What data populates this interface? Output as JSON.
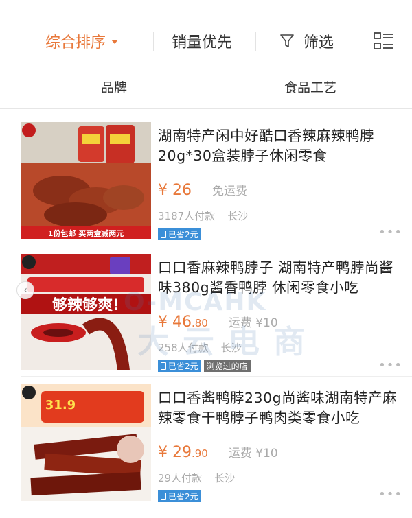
{
  "sort_bar": {
    "comprehensive": "综合排序",
    "sales": "销量优先",
    "filter": "筛选"
  },
  "sub_filters": {
    "brand": "品牌",
    "process": "食品工艺"
  },
  "products": [
    {
      "title": "湖南特产闲中好酷口香辣麻辣鸭脖20g*30盒装脖子休闲零食",
      "price_symbol": "¥",
      "price_int": "26",
      "price_dec": "",
      "shipping": "免运费",
      "paid": "3187人付款",
      "city": "长沙",
      "badges": [
        "已省2元"
      ],
      "more": "•••",
      "thumb_banner": "1份包邮 买两盒减两元"
    },
    {
      "title": "口口香麻辣鸭脖子 湖南特产鸭脖尚酱味380g酱香鸭脖 休闲零食小吃",
      "price_symbol": "¥",
      "price_int": "46",
      "price_dec": ".80",
      "shipping": "运费 ¥10",
      "paid": "258人付款",
      "city": "长沙",
      "badges": [
        "已省2元",
        "浏览过的店"
      ],
      "more": "•••",
      "thumb_banner": "够辣够爽!"
    },
    {
      "title": "口口香酱鸭脖230g尚酱味湖南特产麻辣零食干鸭脖子鸭肉类零食小吃",
      "price_symbol": "¥",
      "price_int": "29",
      "price_dec": ".90",
      "shipping": "运费 ¥10",
      "paid": "29人付款",
      "city": "长沙",
      "badges": [
        "已省2元"
      ],
      "more": "•••",
      "thumb_banner": "31.9"
    }
  ],
  "colors": {
    "accent": "#e8783a",
    "badge_blue": "#3b8fd8",
    "badge_gray": "#6f6f6f"
  },
  "watermark": {
    "latin": "O-MCAHK",
    "cn": "大云电商"
  }
}
